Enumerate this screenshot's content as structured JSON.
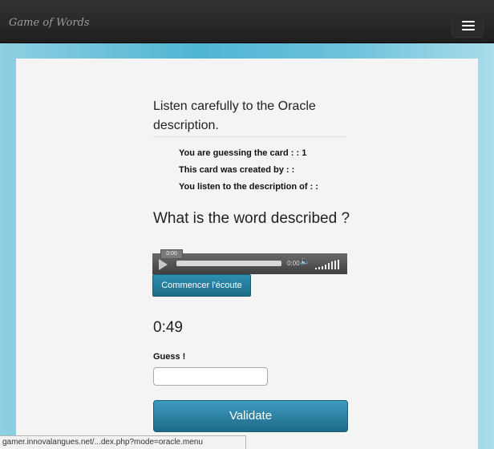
{
  "navbar": {
    "brand": "Game of Words",
    "menu_icon": "hamburger-icon"
  },
  "card": {
    "heading": "Listen carefully to the Oracle description.",
    "info_lines": [
      "You are guessing the card : : 1",
      "This card was created by : :",
      "You listen to the description of : :"
    ],
    "question": "What is the word described ?"
  },
  "player": {
    "bubble_time": "0:00",
    "time": "0:00",
    "speaker_icon": "speaker-icon",
    "volume_icon": "volume-bars-icon"
  },
  "start_button": "Commencer l'écoute",
  "timer": "0:49",
  "guess": {
    "label": "Guess !",
    "value": ""
  },
  "validate_button": "Validate",
  "status_url": "gamer.innovalangues.net/...dex.php?mode=oracle.menu",
  "colors": {
    "navbar": "#222222",
    "button": "#247a9a",
    "panel": "#f4f4f4"
  }
}
